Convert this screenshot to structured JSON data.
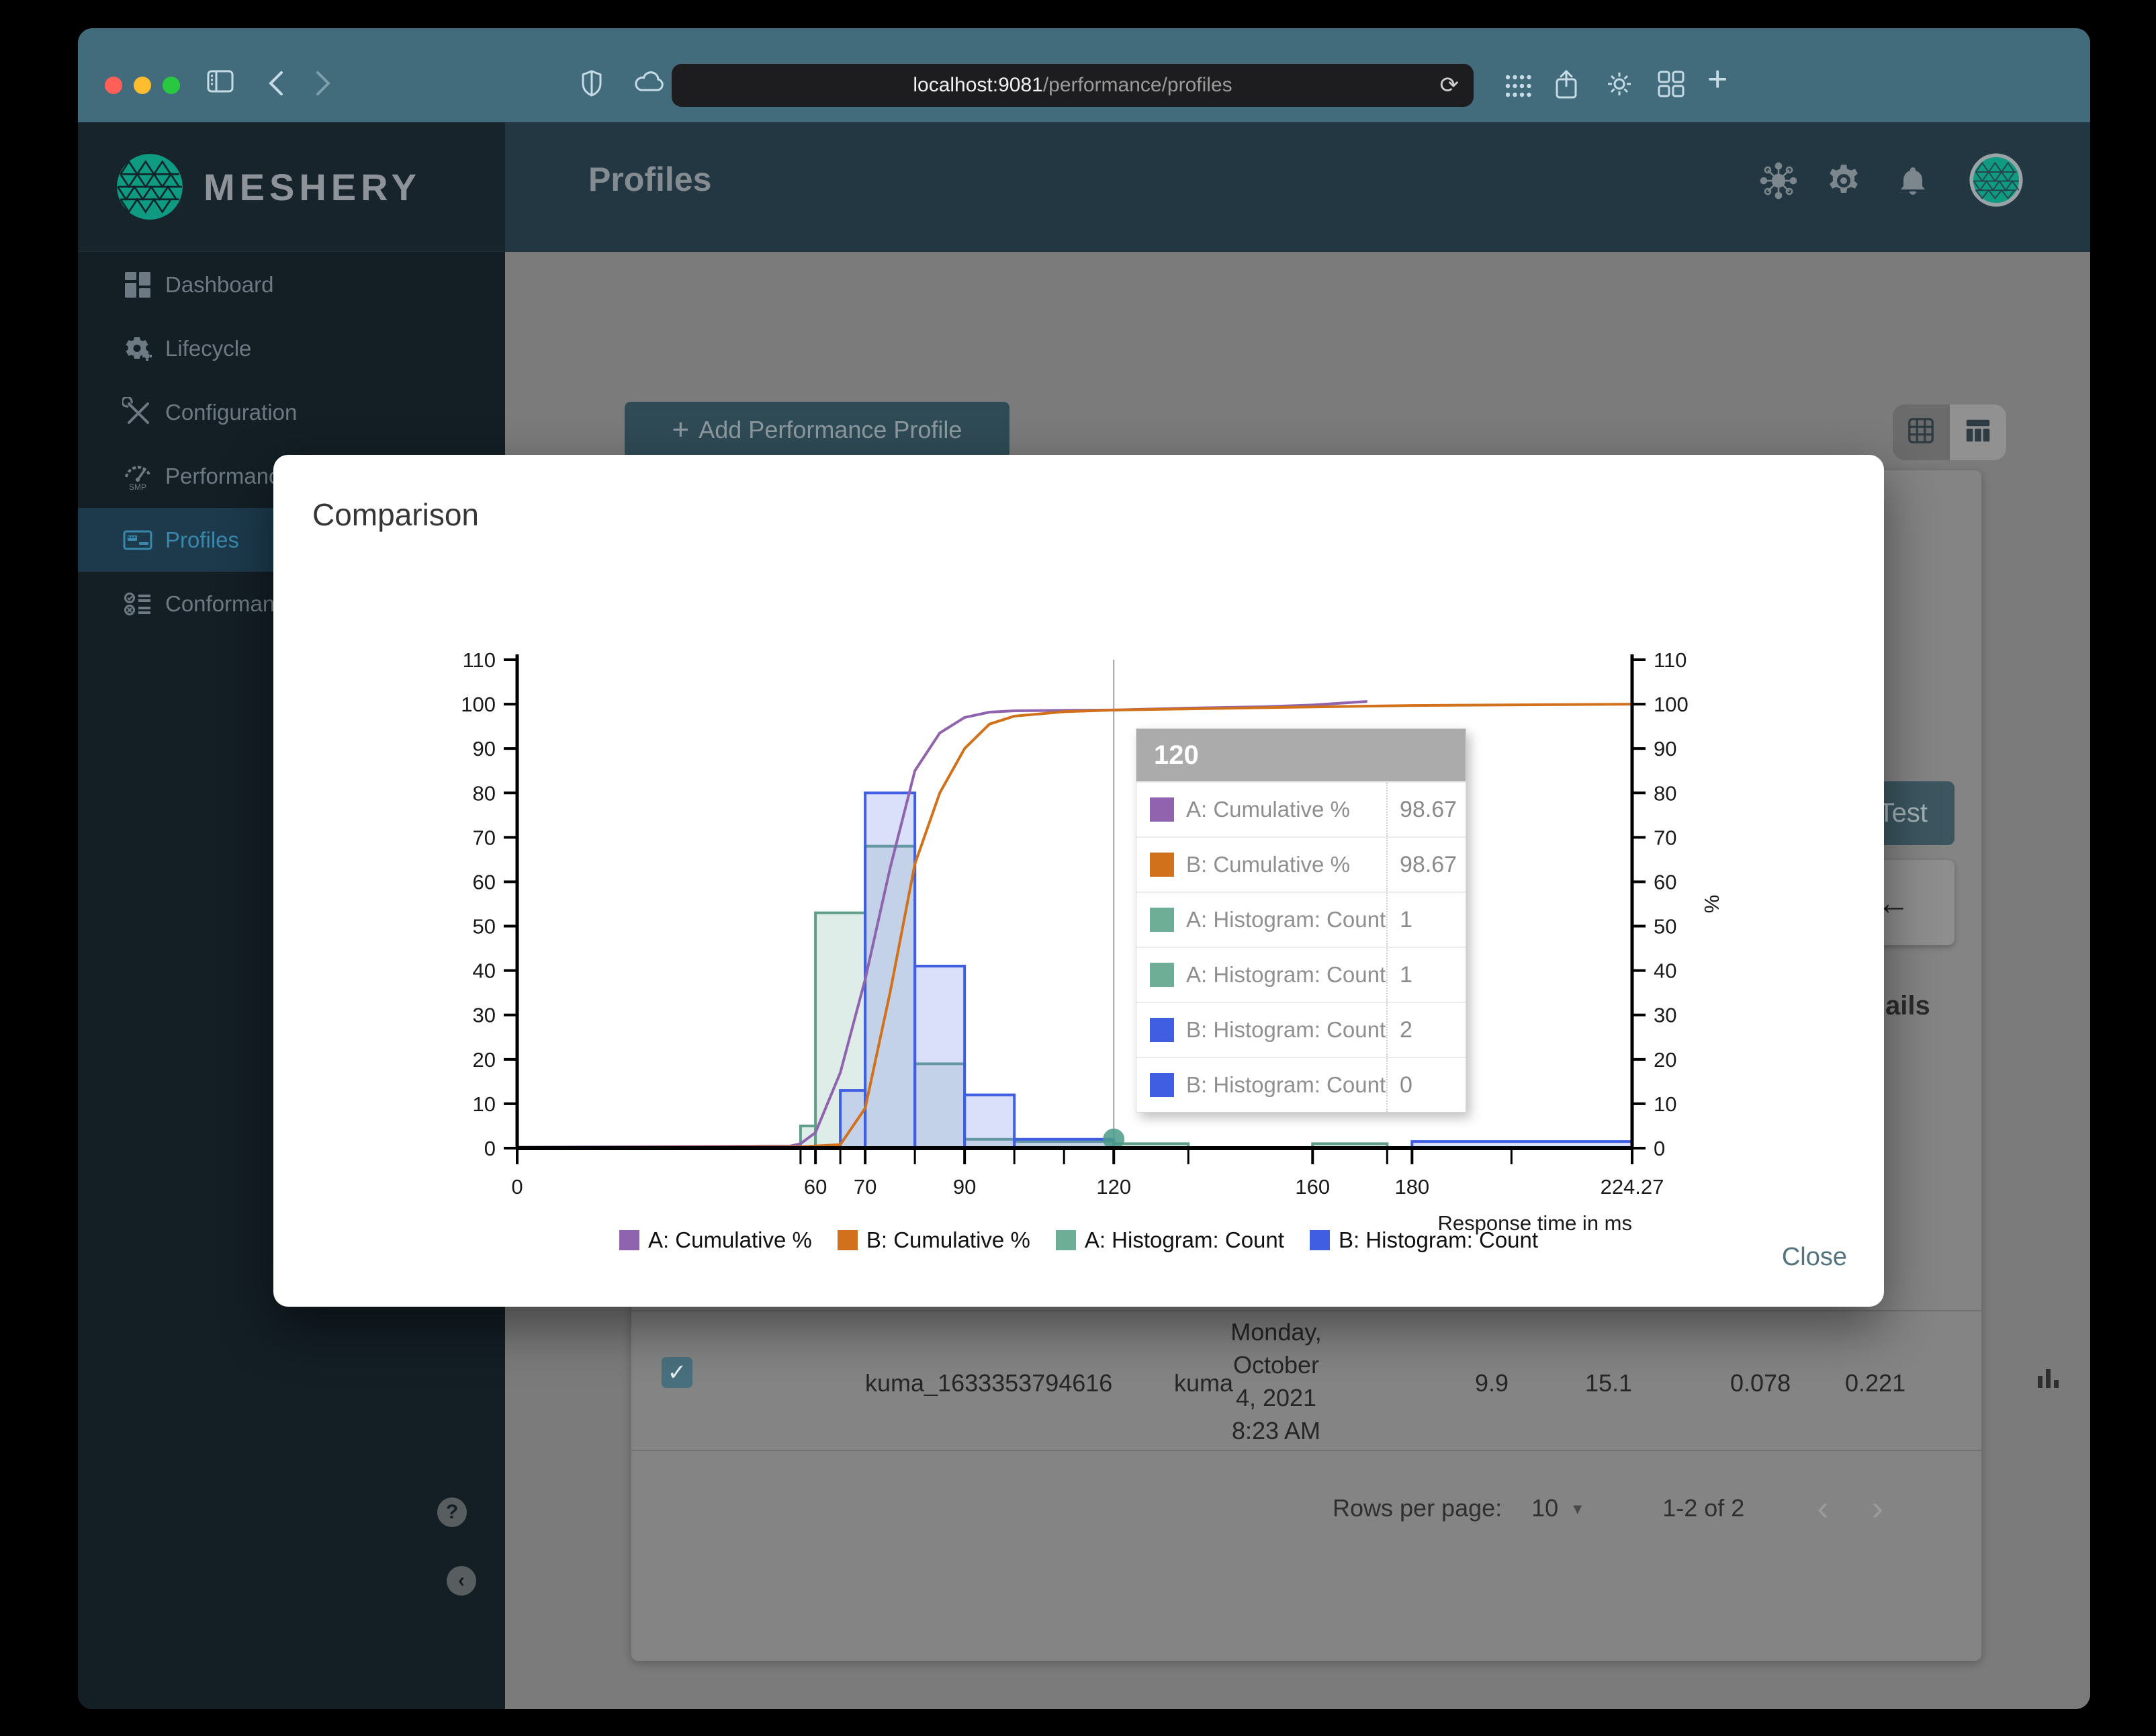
{
  "browser": {
    "url_host": "localhost:9081",
    "url_path": "/performance/profiles",
    "left_icons": [
      "window-sidebar-icon",
      "back-icon",
      "forward-icon"
    ],
    "mid_icons": [
      "shield-icon",
      "cloud-icon"
    ],
    "right_icons": [
      "dots-grid-icon",
      "share-icon",
      "gear-icon",
      "app-grid-icon",
      "plus-icon"
    ]
  },
  "sidebar": {
    "brand": "MESHERY",
    "items": [
      {
        "id": "dashboard",
        "label": "Dashboard",
        "icon": "dashboard",
        "active": false
      },
      {
        "id": "lifecycle",
        "label": "Lifecycle",
        "icon": "lifecycle",
        "active": false
      },
      {
        "id": "configuration",
        "label": "Configuration",
        "icon": "configuration",
        "active": false
      },
      {
        "id": "performance",
        "label": "Performance",
        "icon": "performance",
        "active": false
      },
      {
        "id": "profiles",
        "label": "Profiles",
        "icon": "profiles",
        "active": true
      },
      {
        "id": "conformance",
        "label": "Conformance",
        "icon": "conformance",
        "active": false
      }
    ],
    "help_label": "?",
    "collapse_label": "‹"
  },
  "header": {
    "title": "Profiles"
  },
  "content": {
    "add_button_label": "Add Performance Profile",
    "add_button_plus": "+",
    "test_button": "Test",
    "arrow_glyph": "←",
    "details_fragment": "ails",
    "table_row": {
      "checked": "✓",
      "name": "kuma_1633353794616",
      "mesh": "kuma",
      "date_lines": [
        "Monday,",
        "October",
        "4, 2021",
        "8:23 AM"
      ],
      "qps": "9.9",
      "duration": "15.1",
      "p50": "0.078",
      "p99": "0.221"
    },
    "pagination": {
      "rows_per_page_label": "Rows per page:",
      "rows_per_page": "10",
      "caret": "▾",
      "range": "1-2 of 2",
      "prev": "‹",
      "next": "›"
    }
  },
  "modal": {
    "title": "Comparison",
    "close_label": "Close"
  },
  "chart_data": {
    "type": "mixed",
    "title": "",
    "xlabel": "Response time in ms",
    "ylabel_right": "%",
    "xlim": [
      0,
      224.27
    ],
    "ylim": [
      0,
      110
    ],
    "y_tick_step": 10,
    "x_ticks": {
      "values": [
        0,
        60,
        70,
        90,
        120,
        160,
        180,
        224.27
      ],
      "labels": [
        "0",
        "60",
        "70",
        "90",
        "120",
        "160",
        "180",
        "224.27"
      ]
    },
    "x_minor_ticks": [
      57,
      65,
      80,
      100,
      110,
      135,
      175,
      200
    ],
    "series": [
      {
        "name": "A: Cumulative %",
        "type": "line",
        "color": "#8f63ad",
        "points": [
          [
            0,
            0.2
          ],
          [
            55,
            0.5
          ],
          [
            57,
            1
          ],
          [
            60,
            3.5
          ],
          [
            65,
            17
          ],
          [
            70,
            38
          ],
          [
            75,
            63
          ],
          [
            80,
            85
          ],
          [
            85,
            93.5
          ],
          [
            90,
            97
          ],
          [
            95,
            98.2
          ],
          [
            100,
            98.5
          ],
          [
            110,
            98.6
          ],
          [
            120,
            98.67
          ],
          [
            135,
            99.1
          ],
          [
            150,
            99.4
          ],
          [
            160,
            99.8
          ],
          [
            171,
            100.6
          ]
        ]
      },
      {
        "name": "B: Cumulative %",
        "type": "line",
        "color": "#d2711c",
        "points": [
          [
            0,
            0.1
          ],
          [
            57,
            0.3
          ],
          [
            60,
            0.5
          ],
          [
            65,
            0.8
          ],
          [
            70,
            9
          ],
          [
            75,
            35
          ],
          [
            80,
            64
          ],
          [
            85,
            80
          ],
          [
            90,
            90
          ],
          [
            95,
            95.5
          ],
          [
            100,
            97.3
          ],
          [
            110,
            98.3
          ],
          [
            120,
            98.67
          ],
          [
            150,
            99.2
          ],
          [
            180,
            99.7
          ],
          [
            224.27,
            100
          ]
        ]
      },
      {
        "name": "A: Histogram: Count",
        "type": "histogram",
        "color": "#5f9e8a",
        "fill": "rgba(111,174,150,0.22)",
        "bins": [
          [
            57,
            60,
            5
          ],
          [
            60,
            70,
            53
          ],
          [
            70,
            80,
            68
          ],
          [
            80,
            90,
            19
          ],
          [
            90,
            100,
            2
          ],
          [
            100,
            120,
            1.5
          ],
          [
            120,
            135,
            1
          ],
          [
            160,
            175,
            1
          ]
        ]
      },
      {
        "name": "B: Histogram: Count",
        "type": "histogram",
        "color": "#3f5ee2",
        "fill": "rgba(111,130,235,0.25)",
        "bins": [
          [
            65,
            70,
            13
          ],
          [
            70,
            80,
            80
          ],
          [
            80,
            90,
            41
          ],
          [
            90,
            100,
            12
          ],
          [
            100,
            120,
            2
          ],
          [
            180,
            224.27,
            1.5
          ]
        ]
      }
    ],
    "crosshair": {
      "x": 120,
      "marker_y": 2,
      "marker_color": "#4a9a8a"
    },
    "tooltip": {
      "title": "120",
      "rows": [
        {
          "swatch": "#8f63ad",
          "label": "A: Cumulative %",
          "value": "98.67"
        },
        {
          "swatch": "#d2711c",
          "label": "B: Cumulative %",
          "value": "98.67"
        },
        {
          "swatch": "#6fae96",
          "label": "A: Histogram: Count",
          "value": "1"
        },
        {
          "swatch": "#6fae96",
          "label": "A: Histogram: Count",
          "value": "1"
        },
        {
          "swatch": "#3f5ee2",
          "label": "B: Histogram: Count",
          "value": "2"
        },
        {
          "swatch": "#3f5ee2",
          "label": "B: Histogram: Count",
          "value": "0"
        }
      ]
    },
    "legend": [
      {
        "label": "A: Cumulative %",
        "color": "#8f63ad"
      },
      {
        "label": "B: Cumulative %",
        "color": "#d2711c"
      },
      {
        "label": "A: Histogram: Count",
        "color": "#6fae96"
      },
      {
        "label": "B: Histogram: Count",
        "color": "#3f5ee2"
      }
    ]
  }
}
